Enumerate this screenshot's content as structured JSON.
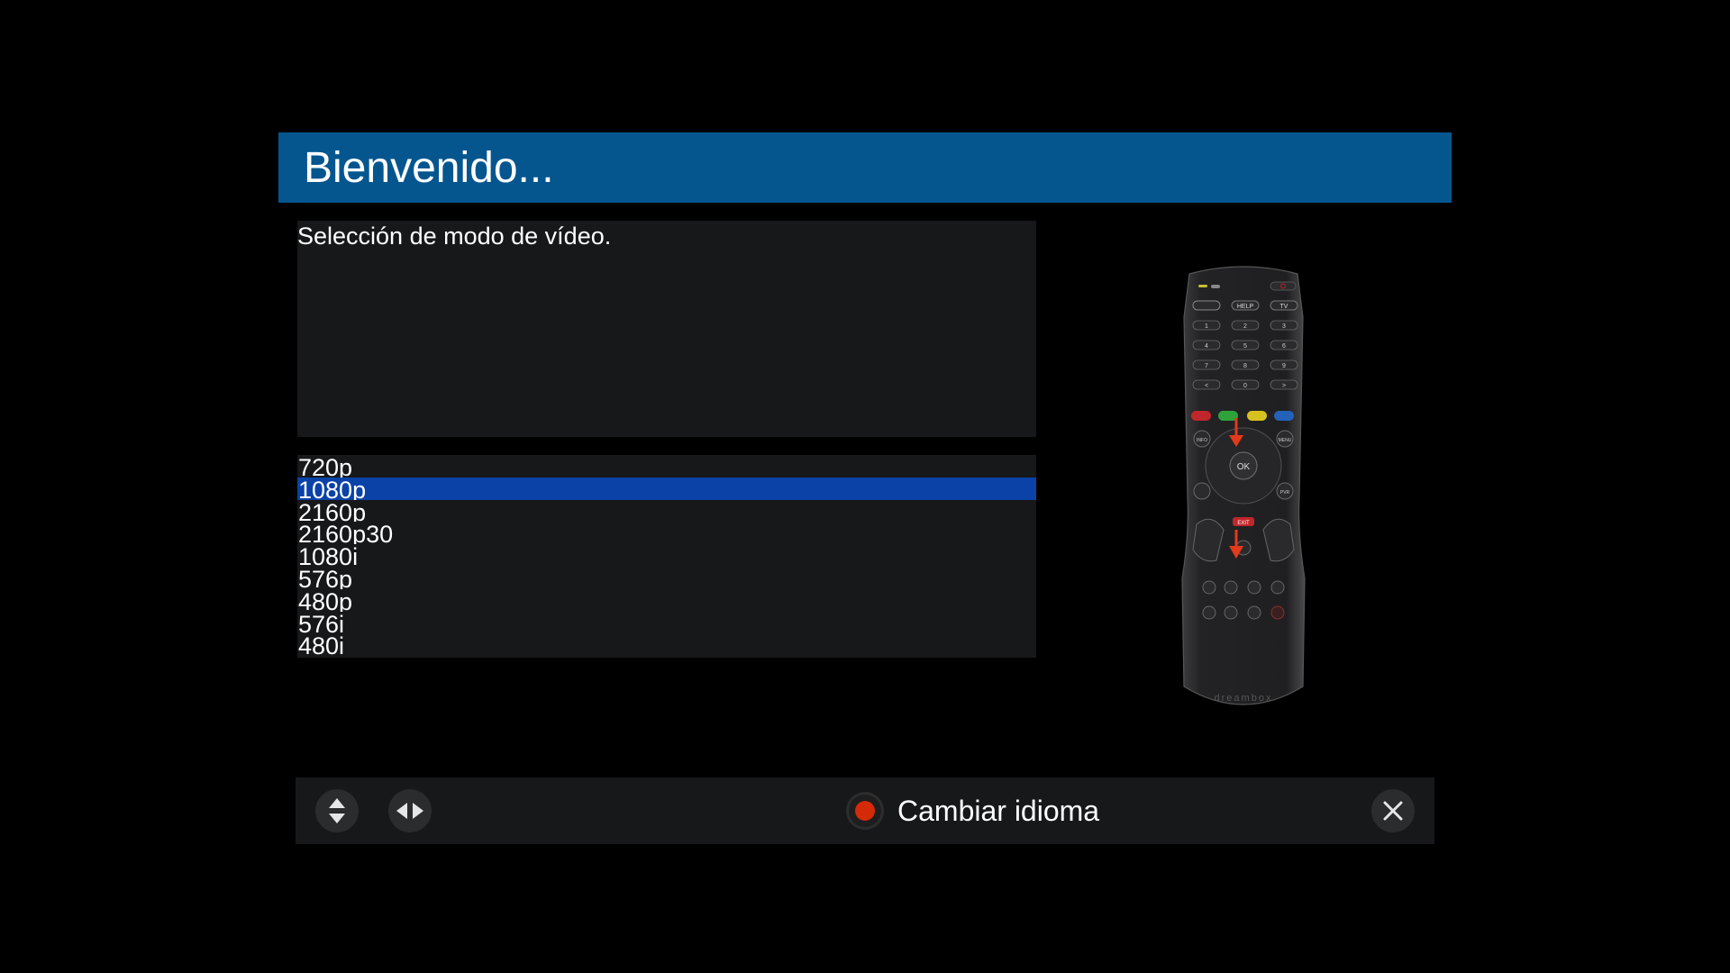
{
  "header": {
    "title": "Bienvenido..."
  },
  "description": {
    "text": "Selección de modo de vídeo."
  },
  "video_modes": {
    "selected_index": 1,
    "items": [
      "720p",
      "1080p",
      "2160p",
      "2160p30",
      "1080i",
      "576p",
      "480p",
      "576i",
      "480i"
    ]
  },
  "remote": {
    "buttons": [
      "HELP",
      "TV",
      "OK",
      "INFO",
      "MENU",
      "EXIT",
      "PVR"
    ],
    "digits": [
      "1",
      "2",
      "3",
      "4",
      "5",
      "6",
      "7",
      "8",
      "9",
      "<",
      "0",
      ">"
    ],
    "brand": "dreambox"
  },
  "footer": {
    "red_action_label": "Cambiar idioma",
    "icons": [
      "up-down-arrows-icon",
      "left-right-arrows-icon",
      "red-button-icon",
      "close-icon"
    ]
  },
  "colors": {
    "header_bg": "#05568f",
    "selection_bg": "#0a42a8",
    "panel_bg": "#17181a",
    "red_button": "#d42a07"
  }
}
